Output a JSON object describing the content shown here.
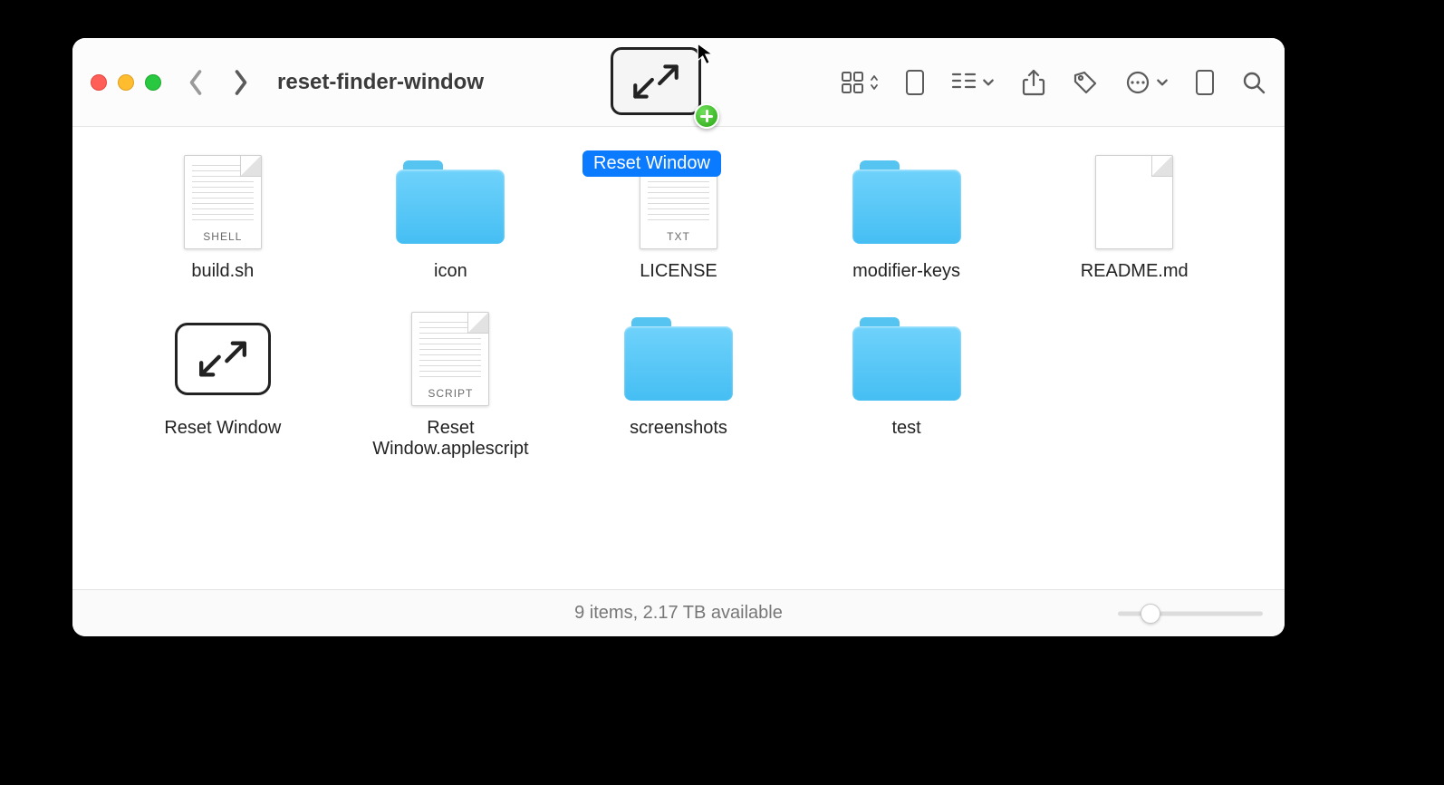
{
  "window": {
    "title": "reset-finder-window",
    "drag_label": "Reset Window"
  },
  "status": {
    "text": "9 items, 2.17 TB available"
  },
  "items": [
    {
      "name": "build.sh",
      "kind": "file",
      "badge": "SHELL"
    },
    {
      "name": "icon",
      "kind": "folder",
      "badge": ""
    },
    {
      "name": "LICENSE",
      "kind": "file",
      "badge": "TXT"
    },
    {
      "name": "modifier-keys",
      "kind": "folder",
      "badge": ""
    },
    {
      "name": "README.md",
      "kind": "file",
      "badge": ""
    },
    {
      "name": "Reset Window",
      "kind": "app",
      "badge": ""
    },
    {
      "name": "Reset Window.applescript",
      "kind": "file",
      "badge": "SCRIPT"
    },
    {
      "name": "screenshots",
      "kind": "folder",
      "badge": ""
    },
    {
      "name": "test",
      "kind": "folder",
      "badge": ""
    }
  ]
}
